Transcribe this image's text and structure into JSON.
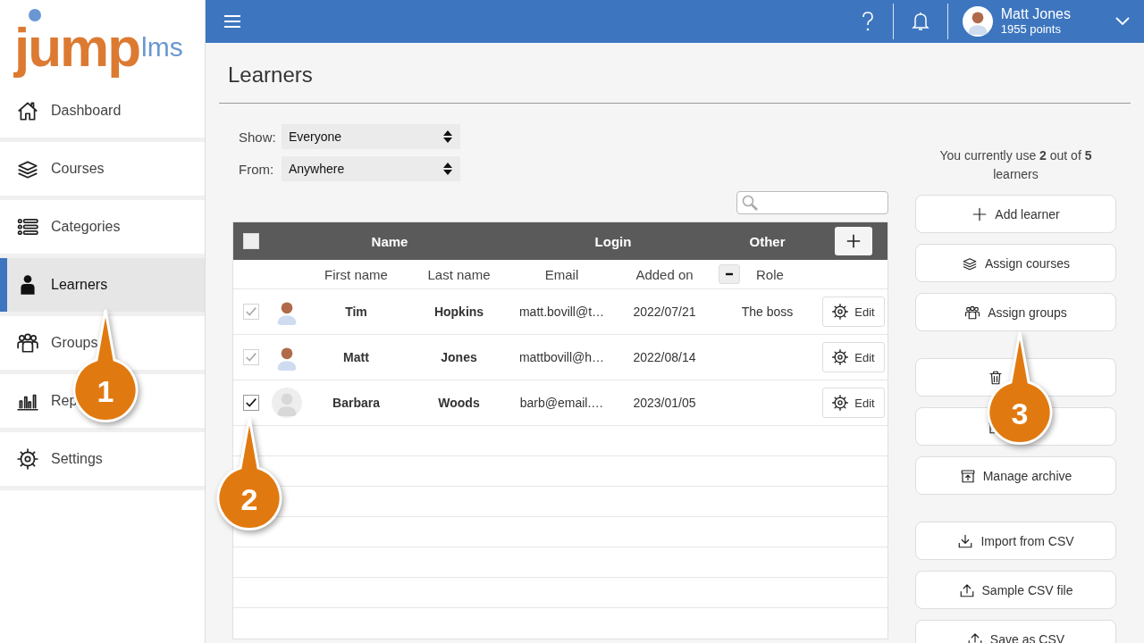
{
  "logo": {
    "primary": "jump",
    "secondary": "lms"
  },
  "sidebar": {
    "items": [
      {
        "label": "Dashboard",
        "selected": false
      },
      {
        "label": "Courses",
        "selected": false
      },
      {
        "label": "Categories",
        "selected": false
      },
      {
        "label": "Learners",
        "selected": true
      },
      {
        "label": "Groups",
        "selected": false
      },
      {
        "label": "Rep",
        "selected": false
      },
      {
        "label": "Settings",
        "selected": false
      }
    ]
  },
  "topbar": {
    "user": {
      "name": "Matt Jones",
      "points": "1955 points"
    }
  },
  "page": {
    "title": "Learners"
  },
  "filters": [
    {
      "label": "Show:",
      "value": "Everyone"
    },
    {
      "label": "From:",
      "value": "Anywhere"
    }
  ],
  "table": {
    "select_all": {
      "checked": false
    },
    "groups": [
      "Name",
      "Login",
      "Other"
    ],
    "columns": [
      "First name",
      "Last name",
      "Email",
      "Added on",
      "Role"
    ],
    "rows": [
      {
        "first": "Tim",
        "last": "Hopkins",
        "email": "matt.bovill@t…",
        "added": "2022/07/21",
        "role": "The boss",
        "kind": "photo",
        "checked": true,
        "disabled": true,
        "action": "Edit"
      },
      {
        "first": "Matt",
        "last": "Jones",
        "email": "mattbovill@h…",
        "added": "2022/08/14",
        "kind": "photo",
        "checked": true,
        "disabled": true,
        "action": "Edit"
      },
      {
        "first": "Barbara",
        "last": "Woods",
        "email": "barb@email.…",
        "added": "2023/01/05",
        "kind": "placeholder",
        "checked": true,
        "disabled": false,
        "action": "Edit"
      }
    ]
  },
  "usage": "You currently use **2** out of **5** learners",
  "actions": [
    [
      {
        "kind": "labeled",
        "label": "Add learner"
      },
      {
        "kind": "labeled",
        "label": "Assign courses"
      },
      {
        "kind": "labeled",
        "label": "Assign groups"
      }
    ],
    [
      {
        "kind": "covered"
      },
      {
        "kind": "covered"
      },
      {
        "kind": "labeled",
        "label": "Manage archive"
      }
    ],
    [
      {
        "kind": "labeled",
        "label": "Import from CSV"
      },
      {
        "kind": "labeled",
        "label": "Sample CSV file"
      },
      {
        "kind": "labeled",
        "label": "Save as CSV"
      }
    ]
  ],
  "callouts": [
    {
      "number": "1"
    },
    {
      "number": "2"
    },
    {
      "number": "3"
    }
  ]
}
